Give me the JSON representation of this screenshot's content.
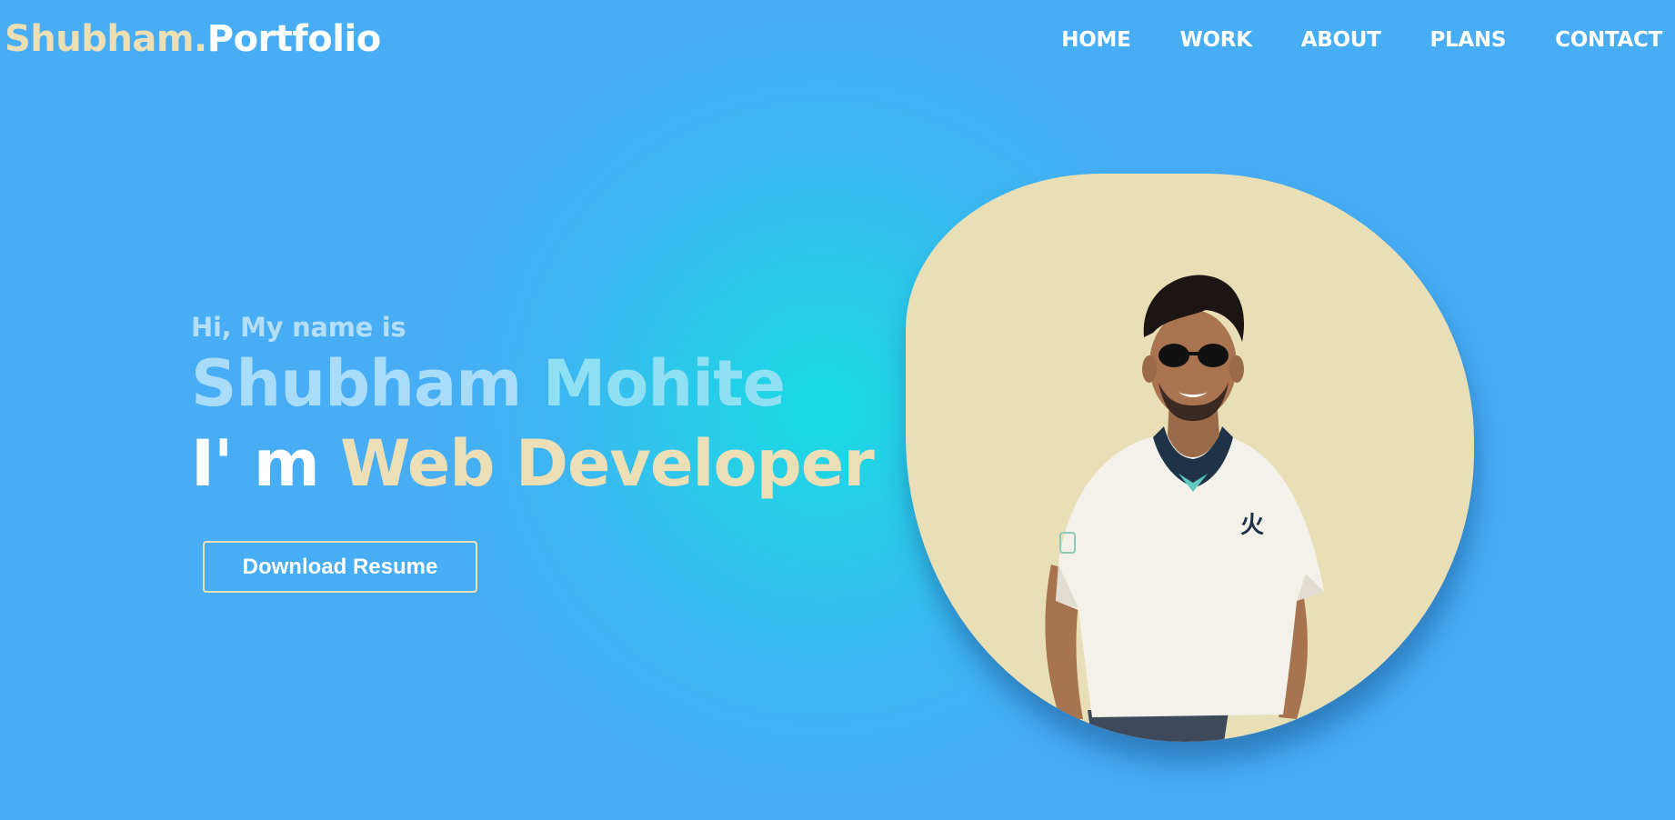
{
  "brand": {
    "first": "Shubham.",
    "second": "Portfolio"
  },
  "nav": {
    "items": [
      "HOME",
      "WORK",
      "ABOUT",
      "PLANS",
      "CONTACT"
    ]
  },
  "hero": {
    "greeting": "Hi, My name is",
    "first_name": "Shubham",
    "last_name": "Mohite",
    "role_prefix": "I' m",
    "role_title": "Web Developer",
    "resume_button": "Download Resume"
  },
  "colors": {
    "background": "#47adf5",
    "glow": "#18dbe4",
    "accent": "#ecdfb5",
    "blob": "#e9dfb6",
    "text_light": "#ffffff"
  }
}
